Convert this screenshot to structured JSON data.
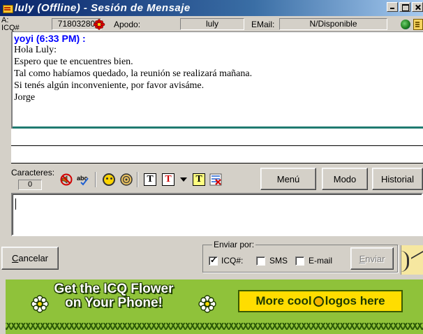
{
  "window": {
    "title": "luly (Offline) - Sesión de Mensaje",
    "title_icon": "message-session-icon"
  },
  "header": {
    "to_label_a": "A:",
    "to_label_b": "ICQ#",
    "icq_number": "71803280",
    "nickname_label": "Apodo:",
    "nickname": "luly",
    "email_label": "EMail:",
    "email": "N/Disponible"
  },
  "history": {
    "sender": "yoyi (6:33 PM) :",
    "lines": [
      "Hola Luly:",
      "Espero que te encuentres bien.",
      "Tal como habíamos quedado, la reunión se realizará mañana.",
      "Si tenés algún inconveniente, por favor avisáme.",
      "Jorge"
    ]
  },
  "toolbar": {
    "chars_label": "Caracteres:",
    "chars_count": "0",
    "menu_button": "Menú",
    "mode_button": "Modo",
    "history_button": "Historial",
    "text_style_glyph": "T"
  },
  "bottom": {
    "cancel_button": "Cancelar",
    "cancel_mnemonic": "C",
    "cancel_rest": "ancelar",
    "send_via_label": "Enviar por:",
    "icq_option": "ICQ#:",
    "sms_option": "SMS",
    "email_option": "E-mail",
    "icq_checked": true,
    "sms_checked": false,
    "email_checked": false,
    "send_mnemonic": "E",
    "send_rest": "nviar"
  },
  "banner": {
    "headline_line1": "Get the ICQ Flower",
    "headline_line2": "on Your Phone!",
    "cta_part1": "More cool",
    "cta_part2": "logos here",
    "bg_color": "#8fc23a",
    "cta_color": "#ffdd00"
  },
  "colors": {
    "sender": "#0000ff",
    "titlebar": "#0a246a",
    "divider": "#1f7a70"
  }
}
